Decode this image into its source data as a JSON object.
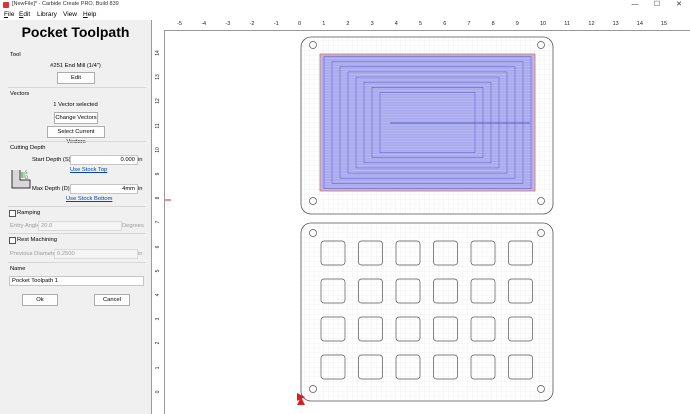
{
  "window": {
    "title": "[NewFile]* - Carbide Create PRO, Build 839",
    "minimize": "—",
    "maximize": "☐",
    "close": "✕"
  },
  "menu": [
    {
      "label": "File",
      "u": "F",
      "rest": "ile"
    },
    {
      "label": "Edit",
      "u": "E",
      "rest": "dit"
    },
    {
      "label": "Library",
      "u": "",
      "rest": "Library"
    },
    {
      "label": "View",
      "u": "",
      "rest": "View"
    },
    {
      "label": "Help",
      "u": "H",
      "rest": "elp"
    }
  ],
  "panel": {
    "title": "Pocket Toolpath",
    "tool": {
      "section": "Tool",
      "name": "#251 End Mill (1/4\")",
      "edit_label": "Edit"
    },
    "vectors": {
      "section": "Vectors",
      "selected": "1 Vector selected",
      "change_label": "Change Vectors",
      "select_label": "Select Current Vectors"
    },
    "depth": {
      "section": "Cutting Depth",
      "start_label": "Start Depth (S)",
      "start_value": "0.000",
      "start_unit": "in",
      "use_top": "Use Stock Top",
      "max_label": "Max Depth (D)",
      "max_value": "4mm",
      "max_unit": "in",
      "use_bottom": "Use Stock Bottom"
    },
    "ramping": {
      "label": "Ramping",
      "angle_label": "Entry Angle",
      "angle_value": "20.0",
      "angle_unit": "Degrees"
    },
    "rest": {
      "label": "Rest Machining",
      "prev_label": "Previous Diameter",
      "prev_value": "0.2500",
      "prev_unit": "in"
    },
    "name": {
      "section": "Name",
      "value": "Pocket Toolpath 1"
    },
    "ok_label": "Ok",
    "cancel_label": "Cancel"
  },
  "ruler": {
    "x_ticks": [
      "-5",
      "-4",
      "-3",
      "-2",
      "-1",
      "0",
      "1",
      "2",
      "3",
      "4",
      "5",
      "6",
      "7",
      "8",
      "9",
      "10",
      "11",
      "12",
      "13",
      "14",
      "15"
    ],
    "y_ticks": [
      "14",
      "13",
      "12",
      "11",
      "10",
      "9",
      "8",
      "7",
      "6",
      "5",
      "4",
      "3",
      "2",
      "1",
      "0"
    ]
  },
  "colors": {
    "pocket_fill": "#b9b9f5",
    "toolpath_line": "#3a3aa8",
    "vector_outline": "#e07040",
    "grid": "#e2e2e2",
    "stock_outline": "#555555",
    "origin_marker": "#d62020"
  }
}
